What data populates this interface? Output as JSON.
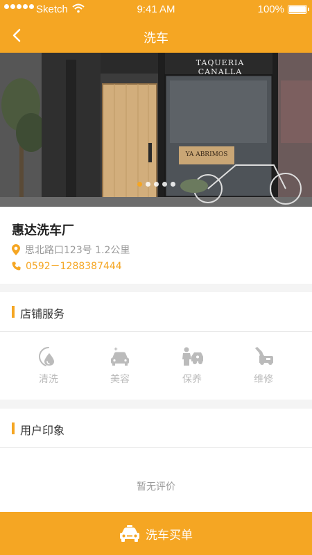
{
  "status_bar": {
    "carrier": "Sketch",
    "time": "9:41 AM",
    "battery": "100%"
  },
  "nav": {
    "title": "洗车"
  },
  "banner": {
    "sign_top": "TAQUERIA CANALLA",
    "sign_door": "YA ABRIMOS",
    "slide_count": 5,
    "active_slide": 0
  },
  "shop": {
    "name": "惠达洗车厂",
    "address": "思北路口123号 1.2公里",
    "phone": "0592－1288387444"
  },
  "services_section": {
    "title": "店铺服务",
    "items": [
      {
        "label": "清洗",
        "icon": "wash-icon"
      },
      {
        "label": "美容",
        "icon": "beauty-icon"
      },
      {
        "label": "保养",
        "icon": "maintenance-icon"
      },
      {
        "label": "维修",
        "icon": "repair-icon"
      }
    ]
  },
  "reviews_section": {
    "title": "用户印象",
    "empty_text": "暂无评价"
  },
  "footer": {
    "button_label": "洗车买单",
    "icon": "car-icon"
  },
  "colors": {
    "accent": "#f5a623",
    "muted": "#bbbbbb"
  }
}
